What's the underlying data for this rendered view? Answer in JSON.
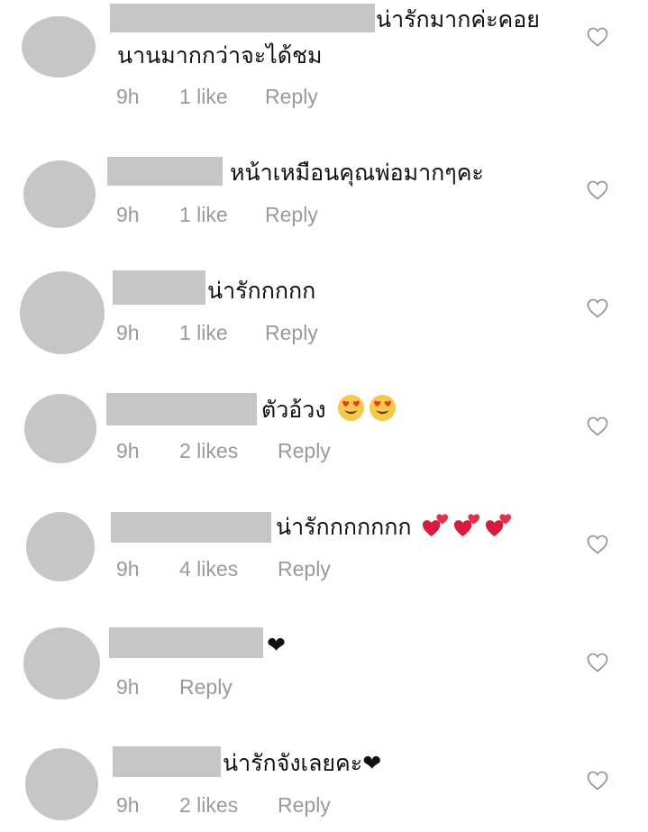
{
  "comments": [
    {
      "text": "น่ารักมากค่ะคอย",
      "text_line2": "นานมากกว่าจะได้ชม",
      "time": "9h",
      "likes": "1 like",
      "reply": "Reply",
      "emojis": [],
      "like_icon": "heart-outline-icon"
    },
    {
      "text": "หน้าเหมือนคุณพ่อมากๆคะ",
      "time": "9h",
      "likes": "1 like",
      "reply": "Reply",
      "emojis": [],
      "like_icon": "heart-outline-icon"
    },
    {
      "text": "น่ารักกกกก",
      "time": "9h",
      "likes": "1 like",
      "reply": "Reply",
      "emojis": [],
      "like_icon": "heart-outline-icon"
    },
    {
      "text": "ตัวอ้วง",
      "time": "9h",
      "likes": "2 likes",
      "reply": "Reply",
      "emojis": [
        "heart-eyes-emoji",
        "heart-eyes-emoji"
      ],
      "like_icon": "heart-outline-icon"
    },
    {
      "text": "น่ารักกกกกกก",
      "time": "9h",
      "likes": "4 likes",
      "reply": "Reply",
      "emojis": [
        "two-hearts-emoji",
        "two-hearts-emoji",
        "two-hearts-emoji"
      ],
      "like_icon": "heart-outline-icon"
    },
    {
      "text": "❤",
      "time": "9h",
      "reply": "Reply",
      "emojis": [],
      "like_icon": "heart-outline-icon"
    },
    {
      "text": "น่ารักจังเลยคะ❤",
      "time": "9h",
      "likes": "2 likes",
      "reply": "Reply",
      "emojis": [],
      "like_icon": "heart-outline-icon"
    }
  ],
  "colors": {
    "avatar_placeholder": "#c6c6c6",
    "meta_text": "#9a9a9a",
    "comment_text": "#111111",
    "heart_outline": "#8e8e8e"
  }
}
